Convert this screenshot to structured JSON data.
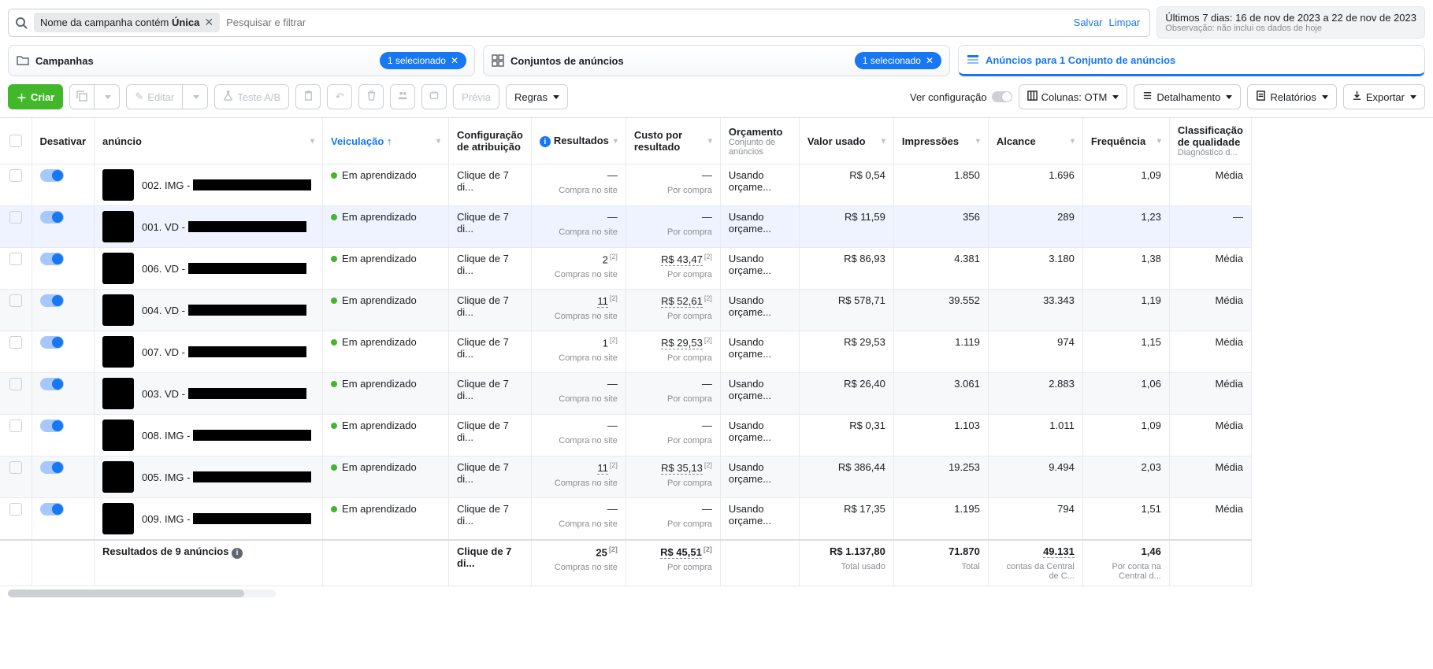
{
  "filter": {
    "chip_prefix": "Nome da campanha contém ",
    "chip_bold": "Única",
    "search_placeholder": "Pesquisar e filtrar",
    "save": "Salvar",
    "clear": "Limpar"
  },
  "date": {
    "main": "Últimos 7 dias: 16 de nov de 2023 a 22 de nov de 2023",
    "sub": "Observação: não inclui os dados de hoje"
  },
  "tabs": {
    "campaigns": "Campanhas",
    "adsets": "Conjuntos de anúncios",
    "ads": "Anúncios para 1 Conjunto de anúncios",
    "selected": "1 selecionado"
  },
  "toolbar": {
    "create": "Criar",
    "edit": "Editar",
    "abtest": "Teste A/B",
    "preview": "Prévia",
    "rules": "Regras",
    "view_config": "Ver configuração",
    "columns": "Colunas: OTM",
    "breakdown": "Detalhamento",
    "reports": "Relatórios",
    "export": "Exportar"
  },
  "columns": {
    "toggle_header": "Desativar",
    "ad": "anúncio",
    "delivery": "Veiculação ↑",
    "attribution_l1": "Configuração",
    "attribution_l2": "de atribuição",
    "results": "Resultados",
    "cost_l1": "Custo por",
    "cost_l2": "resultado",
    "budget": "Orçamento",
    "budget_sub": "Conjunto de anúncios",
    "spend": "Valor usado",
    "impressions": "Impressões",
    "reach": "Alcance",
    "frequency": "Frequência",
    "quality_l1": "Classificação",
    "quality_l2": "de qualidade",
    "quality_sub": "Diagnóstico d..."
  },
  "cell_labels": {
    "em_aprendizado": "Em aprendizado",
    "clique7": "Clique de 7 di...",
    "compra_site": "Compra no site",
    "compras_site": "Compras no site",
    "por_compra": "Por compra",
    "usando_orcame": "Usando orçame...",
    "dash": "—",
    "sup2": "[2]"
  },
  "rows": [
    {
      "name_prefix": "002. IMG -",
      "results": "—",
      "results_sub": "Compra no site",
      "cost": "—",
      "cost_sub": "Por compra",
      "spend": "R$ 0,54",
      "imp": "1.850",
      "reach": "1.696",
      "freq": "1,09",
      "qual": "Média"
    },
    {
      "name_prefix": "001. VD -",
      "results": "—",
      "results_sub": "Compra no site",
      "cost": "—",
      "cost_sub": "Por compra",
      "spend": "R$ 11,59",
      "imp": "356",
      "reach": "289",
      "freq": "1,23",
      "qual": "—",
      "selected": true
    },
    {
      "name_prefix": "006. VD -",
      "results": "2",
      "results_sup": true,
      "results_sub": "Compras no site",
      "cost": "R$ 43,47",
      "cost_sup": true,
      "cost_ul": true,
      "cost_sub": "Por compra",
      "spend": "R$ 86,93",
      "imp": "4.381",
      "reach": "3.180",
      "freq": "1,38",
      "qual": "Média"
    },
    {
      "name_prefix": "004. VD -",
      "results": "11",
      "results_sup": true,
      "results_ul": true,
      "results_sub": "Compras no site",
      "cost": "R$ 52,61",
      "cost_sup": true,
      "cost_ul": true,
      "cost_sub": "Por compra",
      "spend": "R$ 578,71",
      "imp": "39.552",
      "reach": "33.343",
      "freq": "1,19",
      "qual": "Média",
      "alt": true
    },
    {
      "name_prefix": "007. VD -",
      "results": "1",
      "results_sup": true,
      "results_sub": "Compra no site",
      "cost": "R$ 29,53",
      "cost_sup": true,
      "cost_ul": true,
      "cost_sub": "Por compra",
      "spend": "R$ 29,53",
      "imp": "1.119",
      "reach": "974",
      "freq": "1,15",
      "qual": "Média"
    },
    {
      "name_prefix": "003. VD -",
      "results": "—",
      "results_sub": "Compra no site",
      "cost": "—",
      "cost_sub": "Por compra",
      "spend": "R$ 26,40",
      "imp": "3.061",
      "reach": "2.883",
      "freq": "1,06",
      "qual": "Média",
      "alt": true
    },
    {
      "name_prefix": "008. IMG -",
      "results": "—",
      "results_sub": "Compra no site",
      "cost": "—",
      "cost_sub": "Por compra",
      "spend": "R$ 0,31",
      "imp": "1.103",
      "reach": "1.011",
      "freq": "1,09",
      "qual": "Média"
    },
    {
      "name_prefix": "005. IMG -",
      "results": "11",
      "results_sup": true,
      "results_ul": true,
      "results_sub": "Compras no site",
      "cost": "R$ 35,13",
      "cost_sup": true,
      "cost_ul": true,
      "cost_sub": "Por compra",
      "spend": "R$ 386,44",
      "imp": "19.253",
      "reach": "9.494",
      "freq": "2,03",
      "qual": "Média",
      "alt": true
    },
    {
      "name_prefix": "009. IMG -",
      "results": "—",
      "results_sub": "Compra no site",
      "cost": "—",
      "cost_sub": "Por compra",
      "spend": "R$ 17,35",
      "imp": "1.195",
      "reach": "794",
      "freq": "1,51",
      "qual": "Média"
    }
  ],
  "totals": {
    "label": "Resultados de 9 anúncios",
    "attr": "Clique de 7 di...",
    "results": "25",
    "results_sub": "Compras no site",
    "cost": "R$ 45,51",
    "cost_sub": "Por compra",
    "spend": "R$ 1.137,80",
    "spend_sub": "Total usado",
    "imp": "71.870",
    "imp_sub": "Total",
    "reach": "49.131",
    "reach_sub": "contas da Central de C...",
    "freq": "1,46",
    "freq_sub": "Por conta na Central d..."
  }
}
